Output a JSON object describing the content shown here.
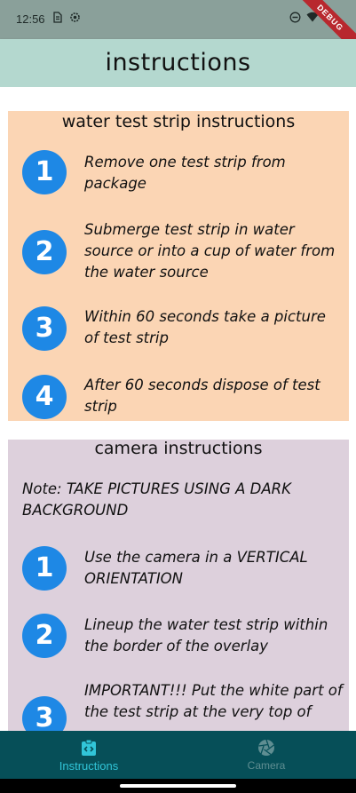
{
  "status_bar": {
    "time": "12:56",
    "left_icons": [
      "sim-icon",
      "settings-icon"
    ],
    "right_icons": [
      "dnd-icon",
      "wifi-icon",
      "battery-icon"
    ],
    "debug_banner": "DEBUG"
  },
  "app_bar": {
    "title": "instructions"
  },
  "strip_card": {
    "title": "water test strip instructions",
    "steps": [
      {
        "number": "1",
        "text": "Remove one test strip from package"
      },
      {
        "number": "2",
        "text": "Submerge test strip in water source or into a cup of water from the water source"
      },
      {
        "number": "3",
        "text": "Within 60 seconds take a picture of test strip"
      },
      {
        "number": "4",
        "text": "After 60 seconds dispose of test strip"
      }
    ]
  },
  "camera_card": {
    "title": "camera instructions",
    "note": "Note: TAKE PICTURES USING A DARK BACKGROUND",
    "steps": [
      {
        "number": "1",
        "text": "Use the camera in a VERTICAL ORIENTATION"
      },
      {
        "number": "2",
        "text": "Lineup the water test strip within the border of the overlay"
      },
      {
        "number": "3",
        "text": "IMPORTANT!!! Put the white part of the test strip at the very top of"
      }
    ]
  },
  "bottom_nav": {
    "items": [
      {
        "label": "Instructions",
        "icon": "instructions-icon",
        "active": true
      },
      {
        "label": "Camera",
        "icon": "camera-aperture-icon",
        "active": false
      }
    ]
  },
  "colors": {
    "status_bar": "#8aa09a",
    "app_bar": "#b4d8cf",
    "strip_card": "#fbd5b4",
    "camera_card": "#ddd0dc",
    "step_circle": "#1e88e5",
    "bottom_nav": "#064f58",
    "nav_active": "#31c5d8",
    "nav_inactive": "#5f8e92"
  }
}
